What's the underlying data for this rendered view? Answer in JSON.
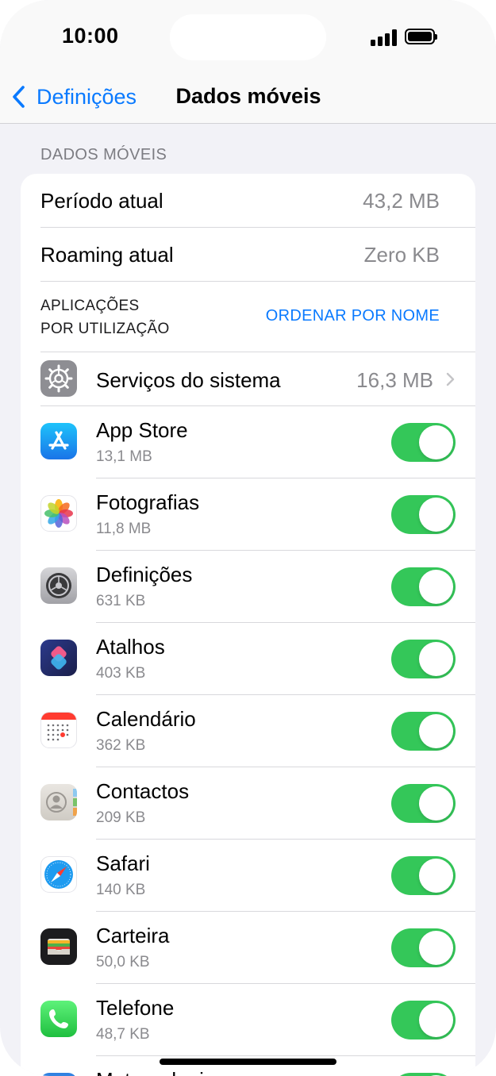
{
  "status_bar": {
    "time": "10:00"
  },
  "nav": {
    "back_label": "Definições",
    "title": "Dados móveis"
  },
  "section_header": "DADOS MÓVEIS",
  "usage": {
    "current_period_label": "Período atual",
    "current_period_value": "43,2 MB",
    "roaming_label": "Roaming atual",
    "roaming_value": "Zero KB"
  },
  "apps_header": {
    "line1": "APLICAÇÕES",
    "line2": "POR UTILIZAÇÃO",
    "sort_link": "ORDENAR POR NOME"
  },
  "system_services": {
    "label": "Serviços do sistema",
    "value": "16,3 MB",
    "icon": "gear-icon"
  },
  "apps": [
    {
      "name": "App Store",
      "size": "13,1 MB",
      "icon": "app-store-icon",
      "enabled": true
    },
    {
      "name": "Fotografias",
      "size": "11,8 MB",
      "icon": "photos-icon",
      "enabled": true
    },
    {
      "name": "Definições",
      "size": "631 KB",
      "icon": "settings-icon",
      "enabled": true
    },
    {
      "name": "Atalhos",
      "size": "403 KB",
      "icon": "shortcuts-icon",
      "enabled": true
    },
    {
      "name": "Calendário",
      "size": "362 KB",
      "icon": "calendar-icon",
      "enabled": true
    },
    {
      "name": "Contactos",
      "size": "209 KB",
      "icon": "contacts-icon",
      "enabled": true
    },
    {
      "name": "Safari",
      "size": "140 KB",
      "icon": "safari-icon",
      "enabled": true
    },
    {
      "name": "Carteira",
      "size": "50,0 KB",
      "icon": "wallet-icon",
      "enabled": true
    },
    {
      "name": "Telefone",
      "size": "48,7 KB",
      "icon": "phone-icon",
      "enabled": true
    },
    {
      "name": "Meteorologia",
      "size": "",
      "icon": "weather-icon",
      "enabled": true
    }
  ],
  "colors": {
    "accent": "#0a7aff",
    "toggle_on": "#34c759",
    "background": "#f2f2f7",
    "secondary_text": "#8a8a8e"
  }
}
